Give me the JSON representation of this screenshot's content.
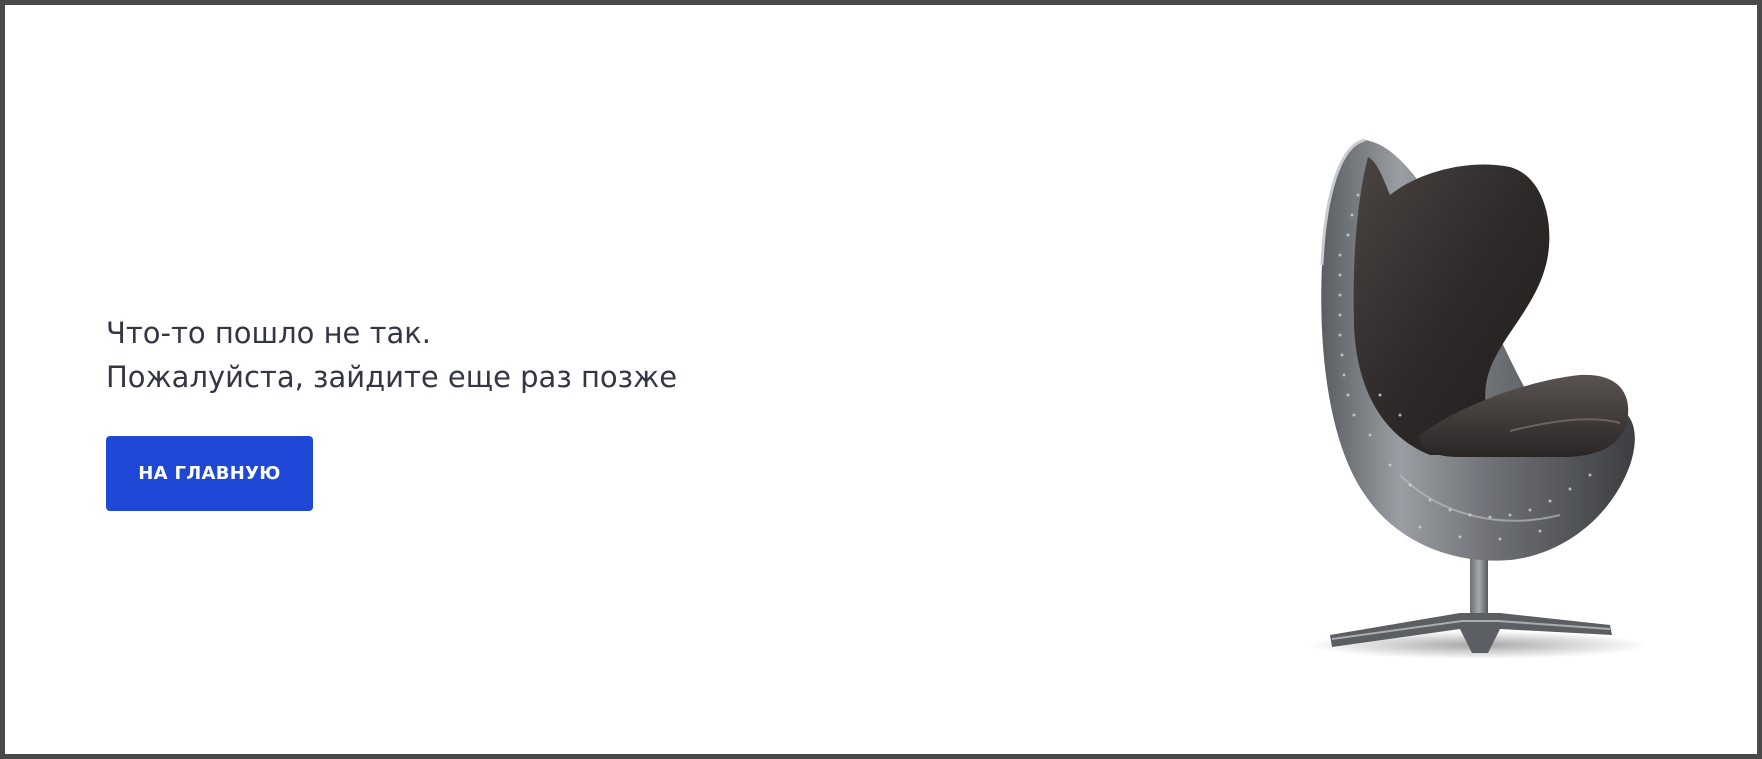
{
  "error": {
    "line1": "Что-то пошло не так.",
    "line2": "Пожалуйста, зайдите еще раз позже"
  },
  "actions": {
    "home_label": "НА ГЛАВНУЮ"
  },
  "illustration": {
    "name": "egg-chair-illustration"
  },
  "colors": {
    "accent": "#1f48d6",
    "text": "#333645",
    "frame": "#4a4a4a"
  }
}
